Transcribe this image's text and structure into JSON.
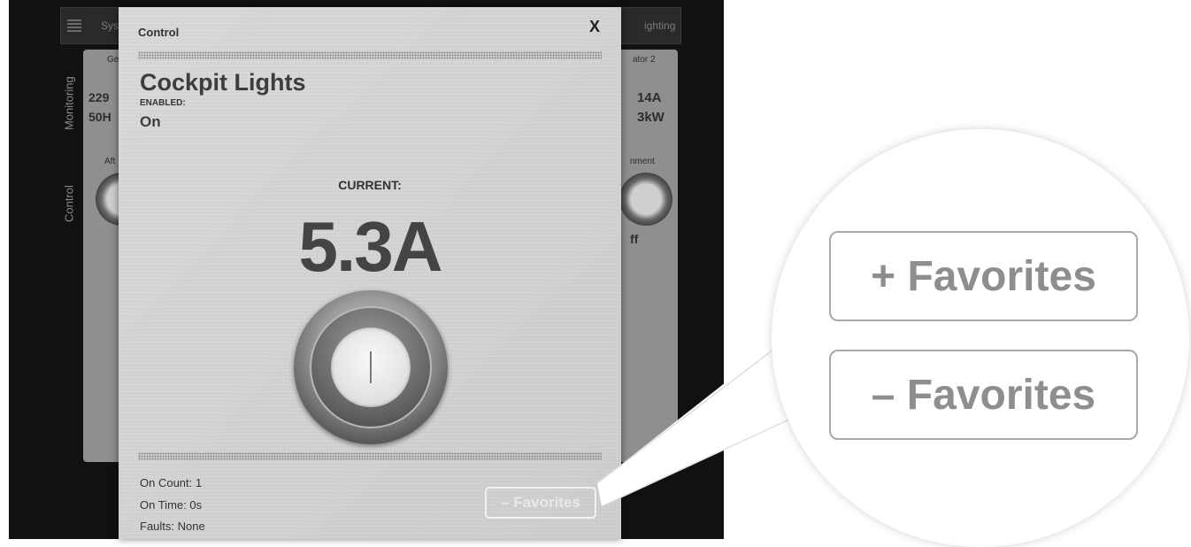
{
  "background": {
    "top_left_tab": "Sys",
    "top_right_tab": "ighting",
    "side_tabs": [
      "Monitoring",
      "Control"
    ],
    "left_values": [
      "229",
      "50H"
    ],
    "right_values": [
      "14A",
      "3kW"
    ],
    "left_small_labels": [
      "Ge",
      "Aft"
    ],
    "right_small_labels": [
      "ator 2",
      "nment"
    ],
    "right_status": "ff"
  },
  "modal": {
    "title": "Control",
    "close_label": "X",
    "device_name": "Cockpit Lights",
    "enabled_label": "ENABLED:",
    "enabled_value": "On",
    "current_label": "CURRENT:",
    "current_value": "5.3A",
    "stats": {
      "on_count": "On Count:  1",
      "on_time": "On Time:  0s",
      "faults": "Faults:  None"
    },
    "favorites_button": "– Favorites"
  },
  "callout": {
    "add_favorites": "+ Favorites",
    "remove_favorites": "– Favorites"
  },
  "colors": {
    "modal_bg": "#d4d4d4",
    "dark_bg": "#111111",
    "button_text": "#8e8e8e"
  }
}
